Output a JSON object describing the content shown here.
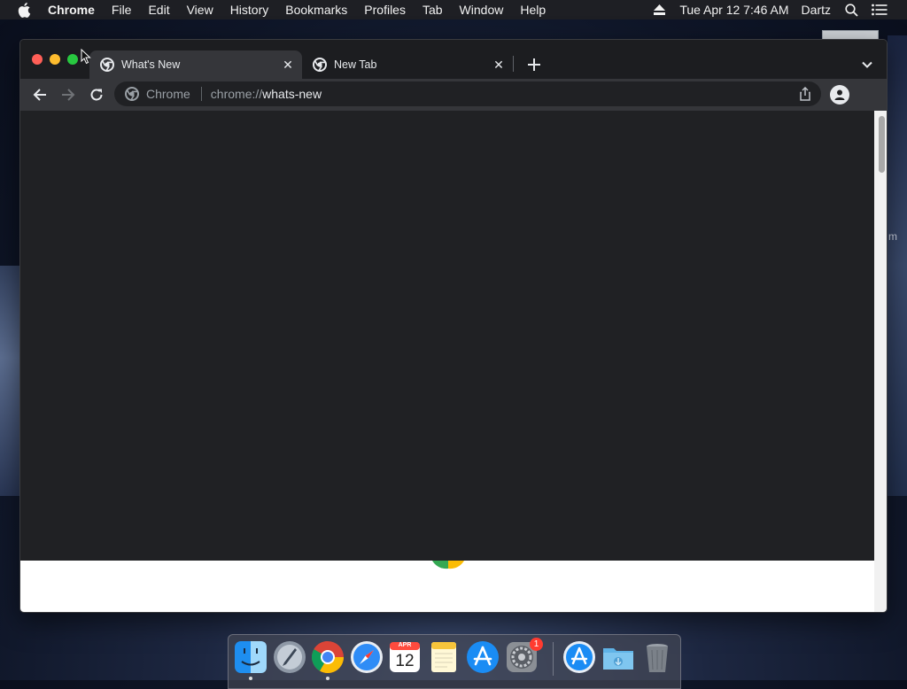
{
  "menubar": {
    "app_name": "Chrome",
    "items": [
      "File",
      "Edit",
      "View",
      "History",
      "Bookmarks",
      "Profiles",
      "Tab",
      "Window",
      "Help"
    ],
    "datetime": "Tue Apr 12  7:46 AM",
    "user": "Dartz"
  },
  "tabs": [
    {
      "title": "What's New",
      "active": true
    },
    {
      "title": "New Tab",
      "active": false
    }
  ],
  "omnibox": {
    "chip": "Chrome",
    "url_scheme": "chrome://",
    "url_host": "whats-new"
  },
  "dock": {
    "calendar_month": "APR",
    "calendar_day": "12",
    "badge_count": "1"
  },
  "desktop": {
    "partial_label": "m"
  },
  "colors": {
    "menubar_bg": "#1e1f24",
    "tabstrip_bg": "#1c1d20",
    "active_tab_bg": "#35363a",
    "page_bg": "#202124",
    "traffic_close": "#ff5f57",
    "traffic_min": "#febc2e",
    "traffic_max": "#28c840"
  }
}
